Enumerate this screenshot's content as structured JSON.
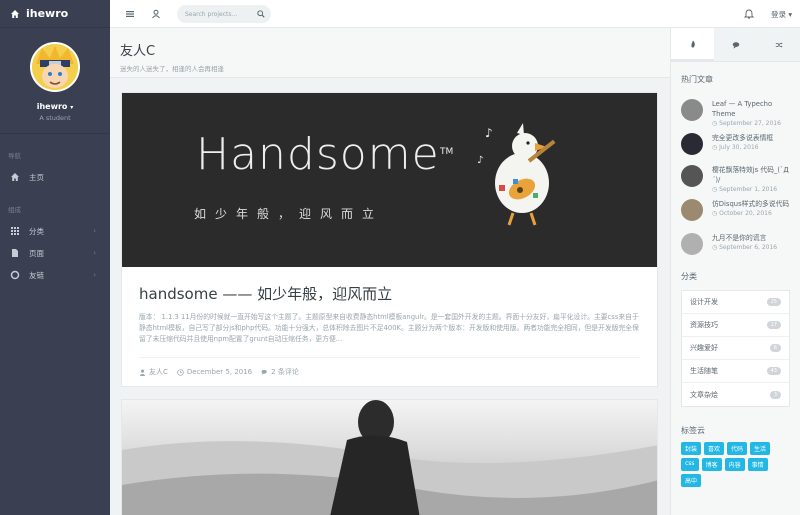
{
  "brand": {
    "name": "ihewro"
  },
  "profile": {
    "name": "ihewro",
    "caret": "▾",
    "desc": "A student"
  },
  "nav": {
    "section1": "导航",
    "home": "主页",
    "section2": "组成",
    "items": [
      {
        "label": "分类",
        "icon": "grid-icon"
      },
      {
        "label": "页面",
        "icon": "file-icon"
      },
      {
        "label": "友链",
        "icon": "circle-icon"
      }
    ]
  },
  "header": {
    "search_placeholder": "Search projects...",
    "login": "登录 ▾"
  },
  "page": {
    "title": "友人C",
    "subtitle": "迷失的人迷失了，相逢的人会再相逢"
  },
  "post1": {
    "banner_title": "Handsome",
    "banner_tm": "TM",
    "banner_tagline": "如少年般，迎风而立",
    "title": "handsome —— 如少年般，迎风而立",
    "excerpt": "版本： 1.1.3 11月份的时候就一直开始写这个主题了。主题原型来自收费静态html模板angulr。是一套国外开发的主题。界面十分友好，扁平化设计。主要css来自于静态html模板，自己写了部分js和php代码。功能十分强大，总体积除去图片不足400K。主题分为两个版本：开发版和使用版。两者功能完全相同，但是开发版完全保留了未压缩代码并且使用npm配置了grunt自动压缩任务，更方便...",
    "author": "友人C",
    "date": "December 5, 2016",
    "comments": "2 条评论"
  },
  "sidebar": {
    "hot_title": "热门文章",
    "hot": [
      {
        "title": "Leaf — A Typecho Theme",
        "date": "September 27, 2016",
        "color": "#8a8a8a"
      },
      {
        "title": "完全更改多说表情框",
        "date": "July 30, 2016",
        "color": "#2a2a35"
      },
      {
        "title": "樱花飘落特效js 代码_(`Д´)/",
        "date": "September 1, 2016",
        "color": "#555555"
      },
      {
        "title": "仿Disqus样式的多说代码",
        "date": "October 20, 2016",
        "color": "#9c8a70"
      },
      {
        "title": "九月不是你的谎言",
        "date": "September 6, 2016",
        "color": "#b0b0b0"
      }
    ],
    "cat_title": "分类",
    "cats": [
      {
        "label": "设计开发",
        "count": "25"
      },
      {
        "label": "资源技巧",
        "count": "17"
      },
      {
        "label": "兴趣爱好",
        "count": "6"
      },
      {
        "label": "生活随笔",
        "count": "43"
      },
      {
        "label": "文章杂烩",
        "count": "3"
      }
    ],
    "tags_title": "标签云",
    "tags": [
      "封装",
      "喜欢",
      "代码",
      "生活",
      "css",
      "博客",
      "内容",
      "事情",
      "高中"
    ]
  }
}
